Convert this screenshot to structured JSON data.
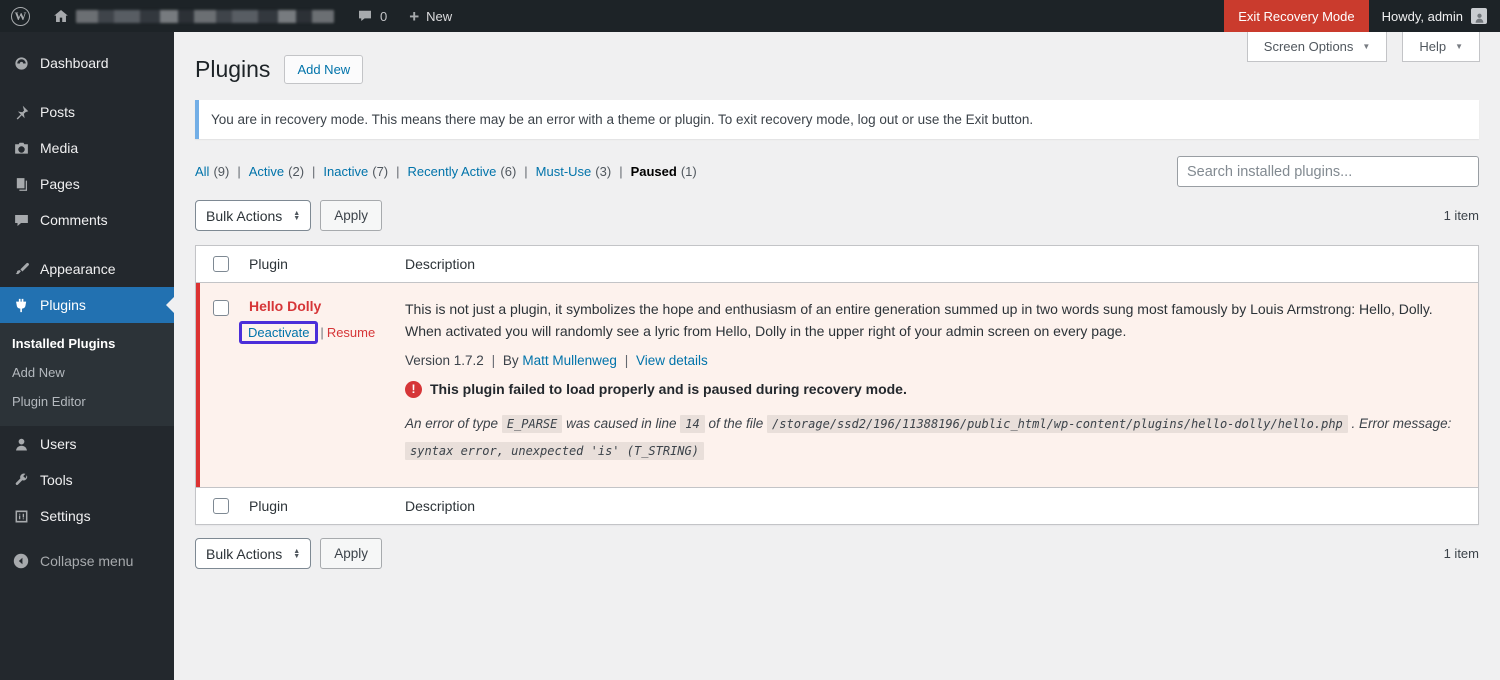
{
  "icons": {
    "plus": "+",
    "chevron_down": "▼",
    "sort_up": "▲",
    "sort_down": "▼",
    "wp_letter": "W",
    "error_mark": "!"
  },
  "pipe": "|",
  "admin_bar": {
    "comments_count": "0",
    "new_label": "New",
    "exit_recovery_label": "Exit Recovery Mode",
    "howdy": "Howdy, admin"
  },
  "sidebar": {
    "items": [
      {
        "label": "Dashboard"
      },
      {
        "label": "Posts"
      },
      {
        "label": "Media"
      },
      {
        "label": "Pages"
      },
      {
        "label": "Comments"
      },
      {
        "label": "Appearance"
      },
      {
        "label": "Plugins"
      },
      {
        "label": "Users"
      },
      {
        "label": "Tools"
      },
      {
        "label": "Settings"
      }
    ],
    "submenu": [
      {
        "label": "Installed Plugins"
      },
      {
        "label": "Add New"
      },
      {
        "label": "Plugin Editor"
      }
    ],
    "collapse_label": "Collapse menu"
  },
  "header": {
    "title": "Plugins",
    "add_new_label": "Add New",
    "screen_options_label": "Screen Options",
    "help_label": "Help"
  },
  "notice": {
    "text": "You are in recovery mode. This means there may be an error with a theme or plugin. To exit recovery mode, log out or use the Exit button."
  },
  "filters": [
    {
      "label": "All",
      "count": "(9)"
    },
    {
      "label": "Active",
      "count": "(2)"
    },
    {
      "label": "Inactive",
      "count": "(7)"
    },
    {
      "label": "Recently Active",
      "count": "(6)"
    },
    {
      "label": "Must-Use",
      "count": "(3)"
    },
    {
      "label": "Paused",
      "count": "(1)"
    }
  ],
  "search": {
    "placeholder": "Search installed plugins..."
  },
  "bulk": {
    "select_label": "Bulk Actions",
    "apply_label": "Apply",
    "item_count": "1 item"
  },
  "table": {
    "columns": {
      "plugin": "Plugin",
      "description": "Description"
    },
    "row": {
      "name": "Hello Dolly",
      "actions": {
        "deactivate": "Deactivate",
        "resume": "Resume"
      },
      "description": "This is not just a plugin, it symbolizes the hope and enthusiasm of an entire generation summed up in two words sung most famously by Louis Armstrong: Hello, Dolly. When activated you will randomly see a lyric from Hello, Dolly in the upper right of your admin screen on every page.",
      "meta": {
        "version": "Version 1.7.2",
        "by": "By",
        "author": "Matt Mullenweg",
        "view_details": "View details"
      },
      "paused_notice": "This plugin failed to load properly and is paused during recovery mode.",
      "error": {
        "prefix": "An error of type",
        "type": "E_PARSE",
        "mid1": "was caused in line",
        "line": "14",
        "mid2": "of the file",
        "file": "/storage/ssd2/196/11388196/public_html/wp-content/plugins/hello-dolly/hello.php",
        "mid3": ". Error message:",
        "message": "syntax error, unexpected 'is' (T_STRING)"
      }
    }
  }
}
